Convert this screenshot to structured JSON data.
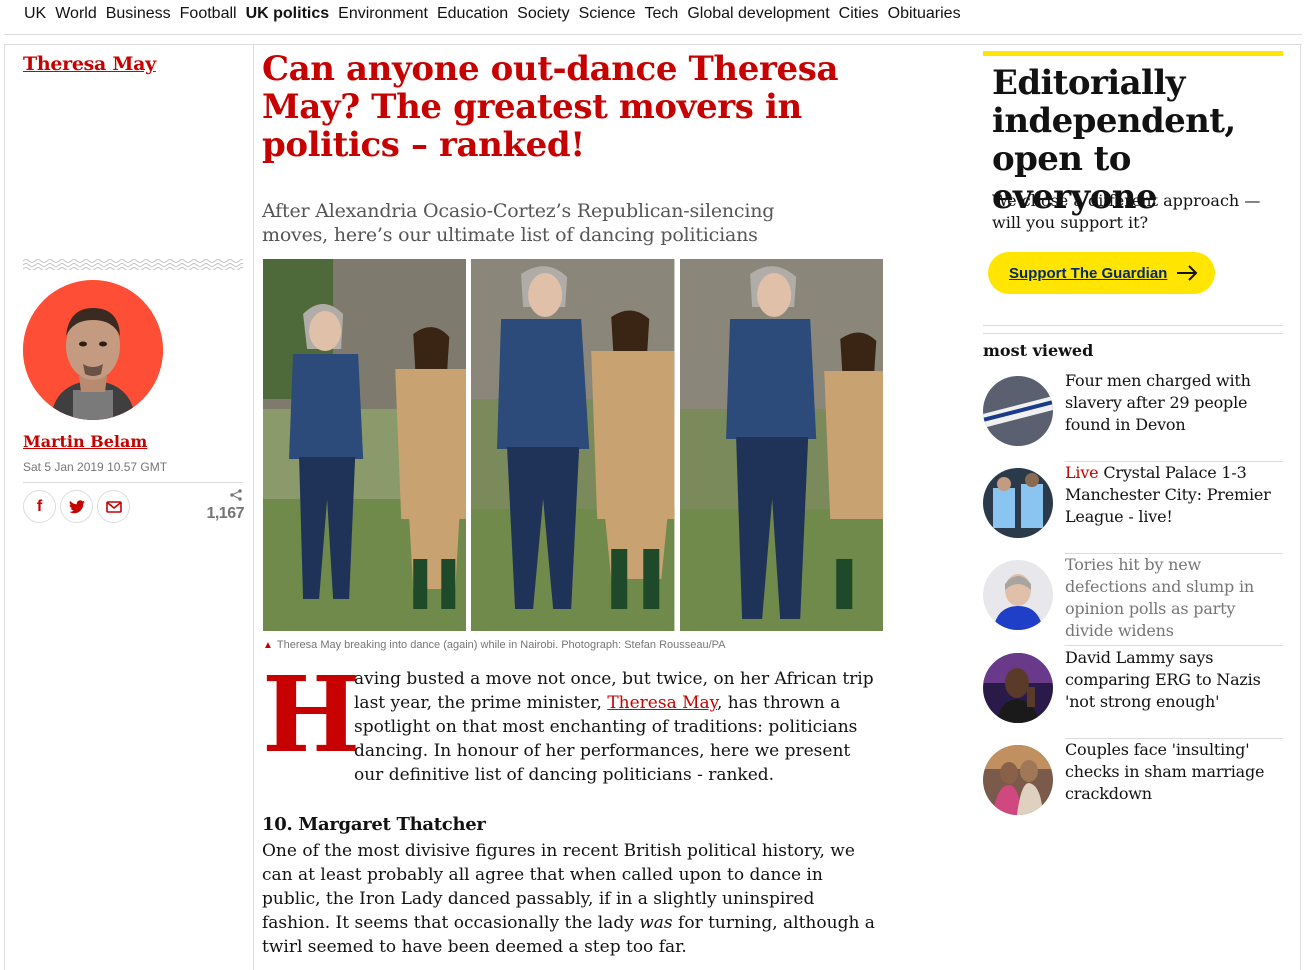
{
  "nav": {
    "items": [
      "UK",
      "World",
      "Business",
      "Football",
      "UK politics",
      "Environment",
      "Education",
      "Society",
      "Science",
      "Tech",
      "Global development",
      "Cities",
      "Obituaries"
    ],
    "active": "UK politics"
  },
  "article": {
    "series": "Theresa May",
    "headline": "Can anyone out-dance Theresa May? The greatest movers in politics – ranked!",
    "standfirst": "After Alexandria Ocasio-Cortez’s Republican-silencing moves, here’s our ultimate list of dancing politicians",
    "caption": "Theresa May breaking into dance (again) while in Nairobi. Photograph: Stefan Rousseau/PA",
    "dropcap": "H",
    "para1_a": "aving busted a move not once, but twice, on her African trip last year, the prime minister, ",
    "para1_link": "Theresa May",
    "para1_b": ", has thrown a spotlight on that most enchanting of traditions: politicians dancing. In honour of her performances, here we present our definitive list of dancing politicians - ranked.",
    "subhead": "10. Margaret Thatcher",
    "para2_a": "One of the most divisive figures in recent British political history, we can at least probably all agree that when called upon to dance in public, the Iron Lady danced passably, if in a slightly uninspired fashion. It seems that occasionally the lady ",
    "para2_em": "was",
    "para2_b": " for turning, although a twirl seemed to have been deemed a step too far."
  },
  "byline": {
    "author": "Martin Belam",
    "date": "Sat 5 Jan 2019 10.57 GMT",
    "share_count": "1,167"
  },
  "support": {
    "heading": "Editorially independent, open to everyone",
    "body": "We chose a different approach — will you support it?",
    "button": "Support The Guardian"
  },
  "most_viewed": {
    "title": "most viewed",
    "items": [
      {
        "live": "",
        "text": "Four men charged with slavery after 29 people found in Devon"
      },
      {
        "live": "Live",
        "text": " Crystal Palace 1-3 Manchester City: Premier League - live!"
      },
      {
        "live": "",
        "text": "Tories hit by new defections and slump in opinion polls as party divide widens"
      },
      {
        "live": "",
        "text": "David Lammy says comparing ERG to Nazis 'not strong enough'"
      },
      {
        "live": "",
        "text": "Couples face 'insulting' checks in sham marriage crackdown"
      }
    ]
  },
  "colors": {
    "brand_red": "#c70000",
    "support_yellow": "#ffe500",
    "navy": "#052962"
  }
}
